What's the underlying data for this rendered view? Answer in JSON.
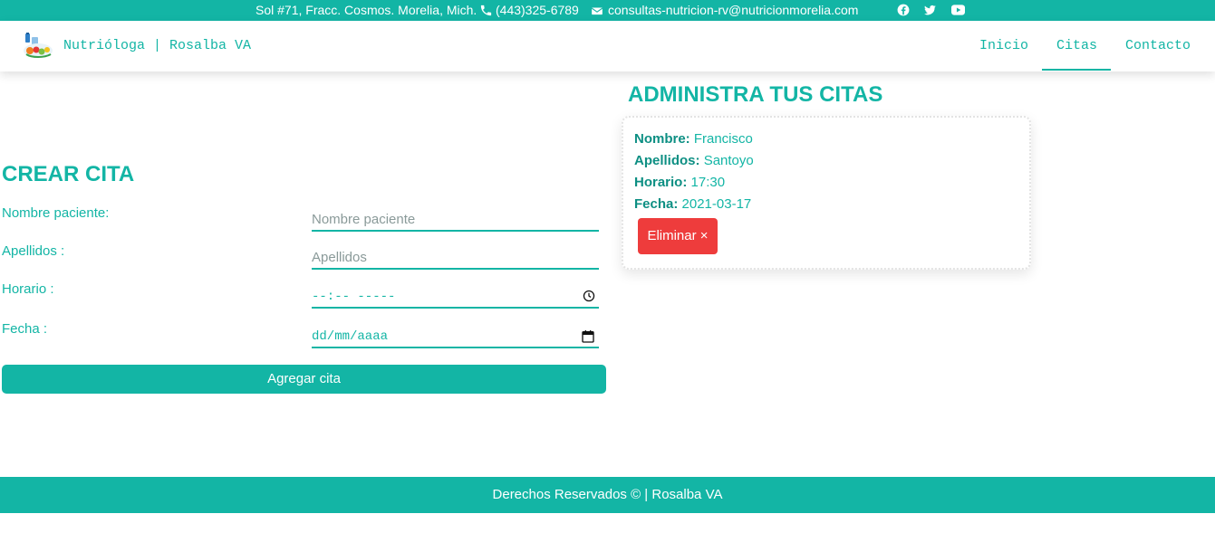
{
  "topbar": {
    "address": "Sol #71, Fracc. Cosmos. Morelia, Mich.",
    "phone": "(443)325-6789",
    "email": "consultas-nutricion-rv@nutricionmorelia.com",
    "icons": [
      "phone-icon",
      "email-icon",
      "facebook-icon",
      "twitter-icon",
      "youtube-icon"
    ]
  },
  "navbar": {
    "brand": "Nutrióloga | Rosalba VA",
    "links": [
      {
        "label": "Inicio",
        "active": false
      },
      {
        "label": "Citas",
        "active": true
      },
      {
        "label": "Contacto",
        "active": false
      }
    ]
  },
  "form": {
    "title": "CREAR CITA",
    "fields": [
      {
        "label": "Nombre paciente:",
        "placeholder": "Nombre paciente"
      },
      {
        "label": "Apellidos :",
        "placeholder": "Apellidos"
      },
      {
        "label": "Horario :",
        "placeholder": "--:-- -----"
      },
      {
        "label": "Fecha :",
        "placeholder": "dd/mm/aaaa"
      }
    ],
    "submit_label": "Agregar cita"
  },
  "appointments": {
    "title": "ADMINISTRA TUS CITAS",
    "items": [
      {
        "nombre_label": "Nombre:",
        "nombre": "Francisco",
        "apellidos_label": "Apellidos:",
        "apellidos": "Santoyo",
        "horario_label": "Horario:",
        "horario": "17:30",
        "fecha_label": "Fecha:",
        "fecha": "2021-03-17",
        "delete_label": "Eliminar ×"
      }
    ]
  },
  "footer": {
    "text": "Derechos Reservados © | Rosalba VA"
  },
  "colors": {
    "accent": "#13b5a5",
    "accent_dark": "#0d8f83",
    "danger": "#ee3c3c"
  }
}
